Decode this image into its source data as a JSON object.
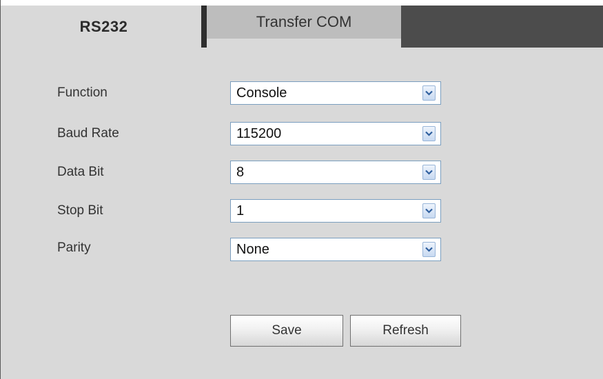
{
  "tabs": [
    {
      "label": "RS232",
      "active": true
    },
    {
      "label": "Transfer COM",
      "active": false
    }
  ],
  "fields": [
    {
      "label": "Function",
      "value": "Console"
    },
    {
      "label": "Baud Rate",
      "value": "115200"
    },
    {
      "label": "Data Bit",
      "value": "8"
    },
    {
      "label": "Stop Bit",
      "value": "1"
    },
    {
      "label": "Parity",
      "value": "None"
    }
  ],
  "buttons": {
    "save_label": "Save",
    "refresh_label": "Refresh"
  },
  "icons": {
    "dropdown": "chevron-down-icon"
  },
  "colors": {
    "panel_bg": "#d9d9d9",
    "inactive_tab_bg": "#bdbdbd",
    "tabbar_dark": "#4c4c4c",
    "dropdown_border": "#7a9ebf",
    "dropdown_arrow": "#2f5f9e"
  }
}
